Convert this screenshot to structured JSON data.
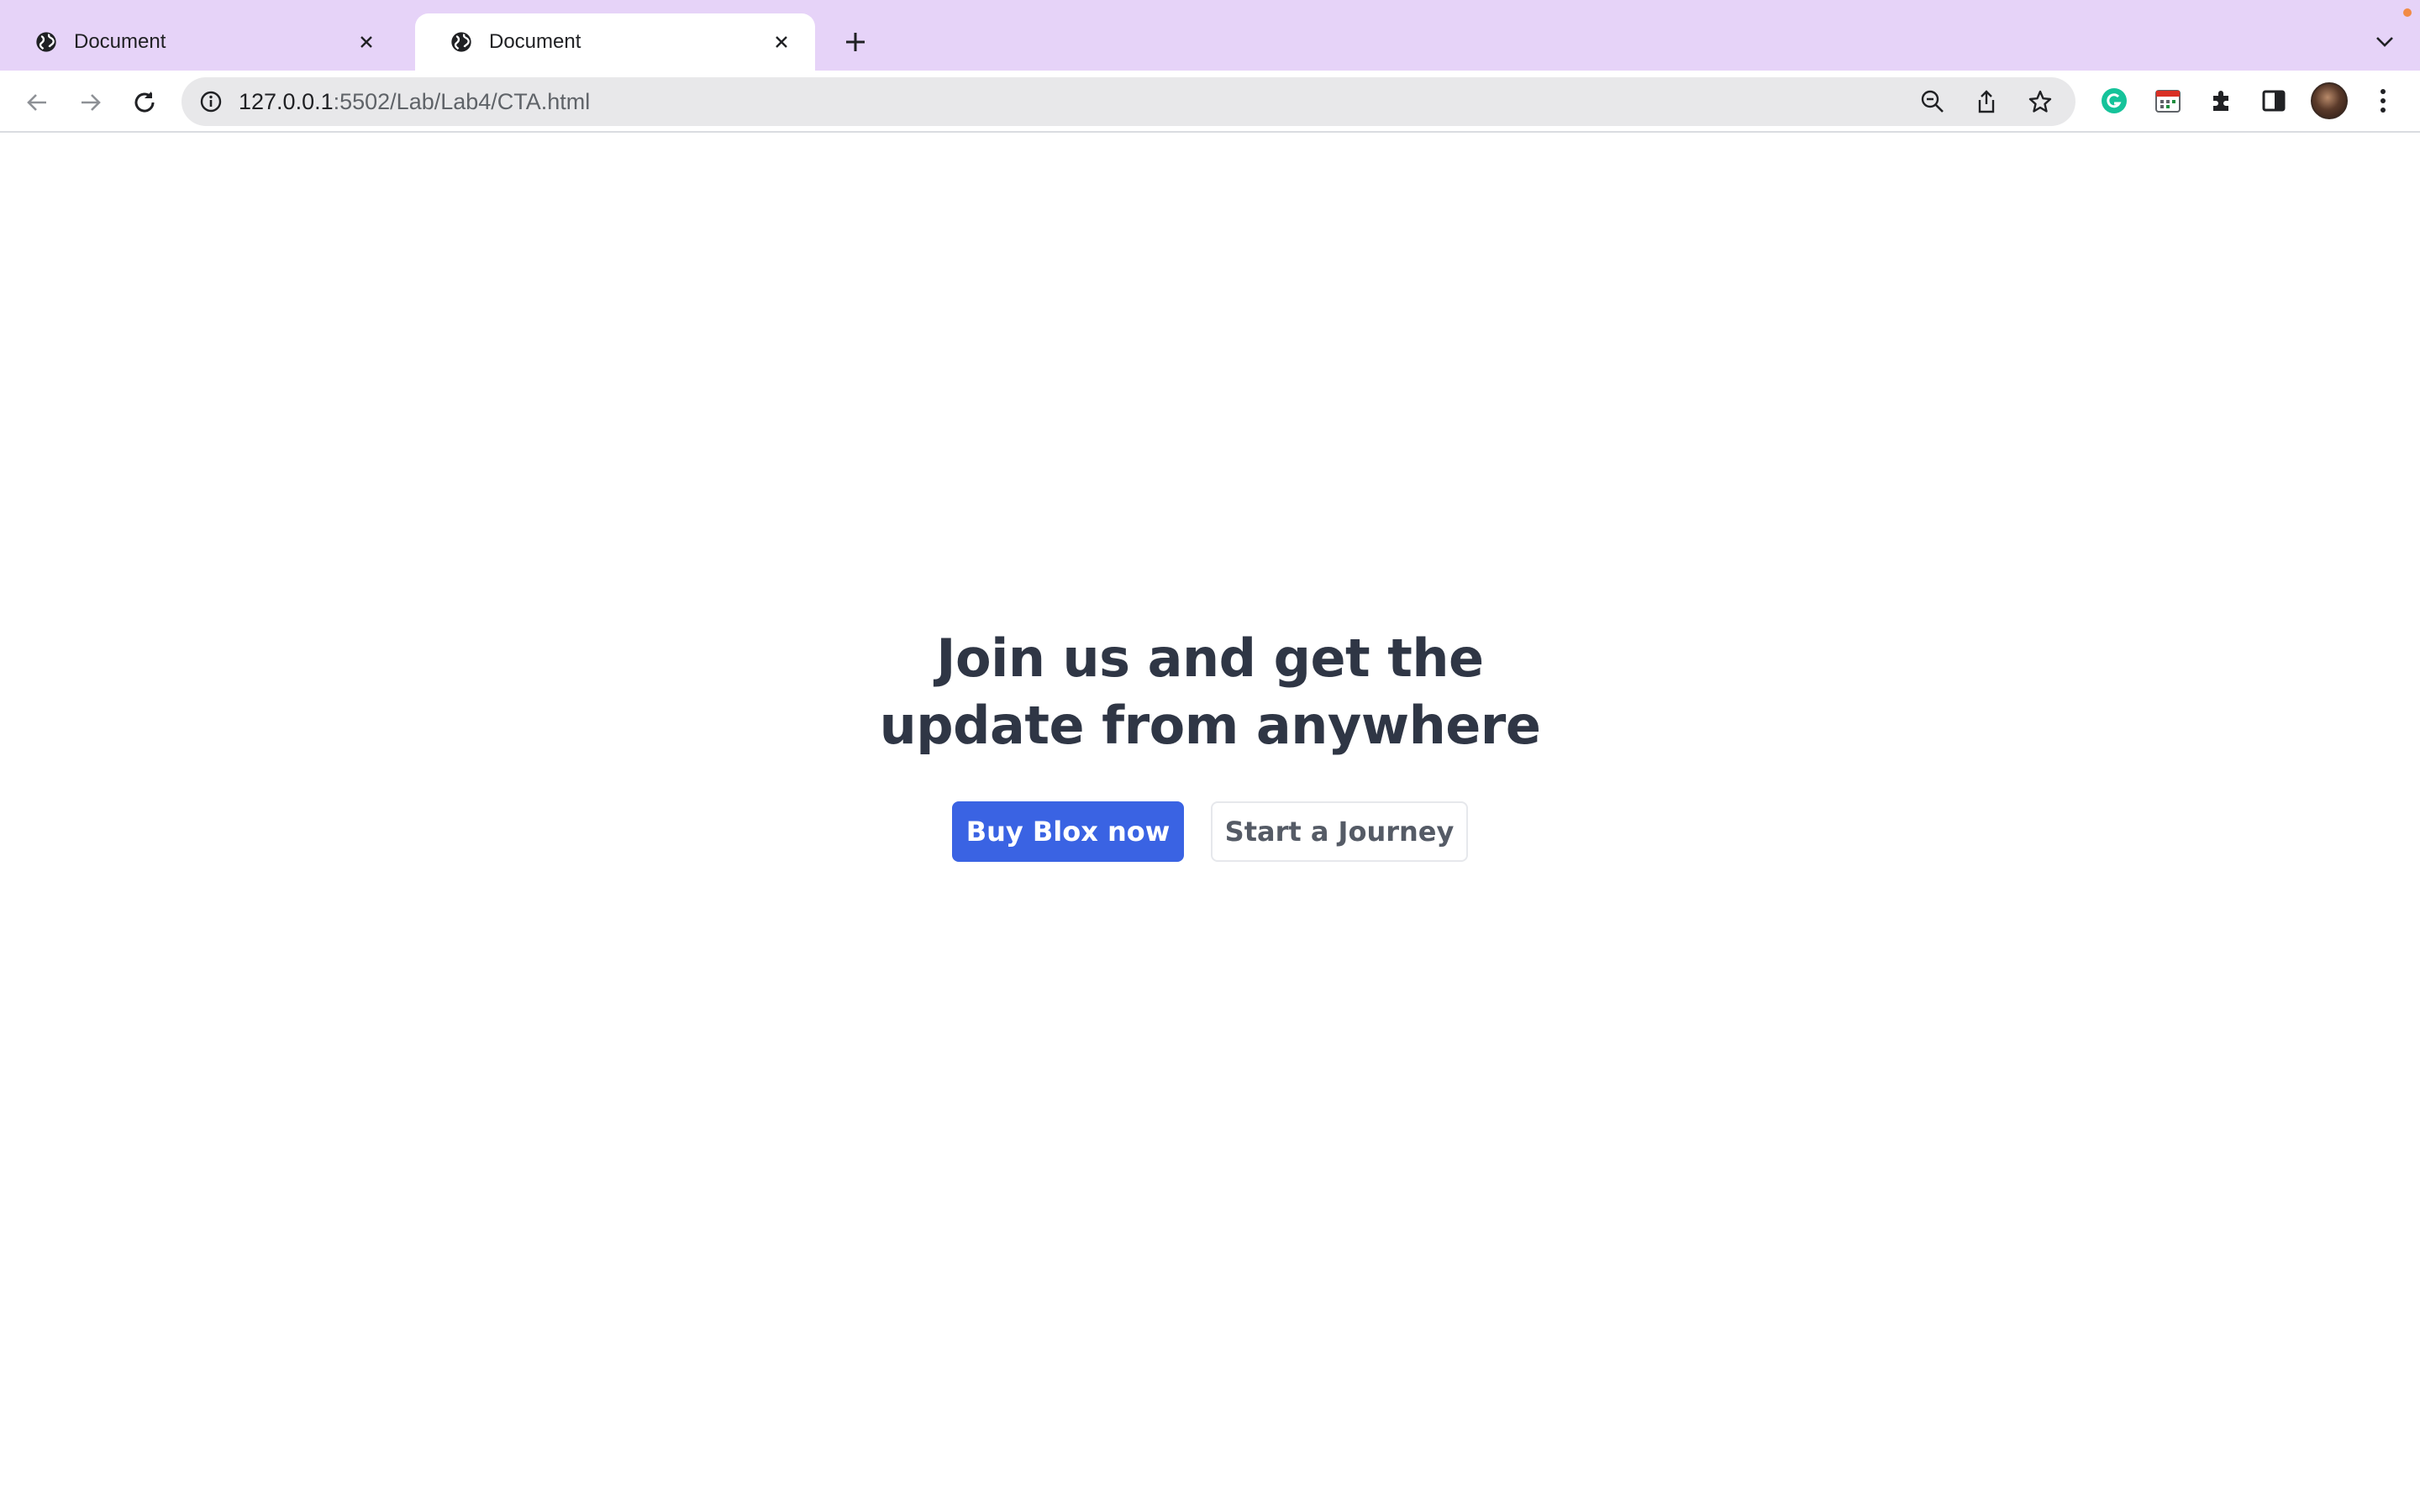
{
  "browser": {
    "tabs": [
      {
        "title": "Document",
        "active": false
      },
      {
        "title": "Document",
        "active": true
      }
    ],
    "url": {
      "host": "127.0.0.1",
      "rest": ":5502/Lab/Lab4/CTA.html"
    },
    "accent_color": "#e6d3f8"
  },
  "page": {
    "heading": "Join us and get the update from anywhere",
    "primary_button": "Buy Blox now",
    "secondary_button": "Start a Journey",
    "primary_color": "#3a63e3",
    "heading_color": "#2f3645"
  }
}
